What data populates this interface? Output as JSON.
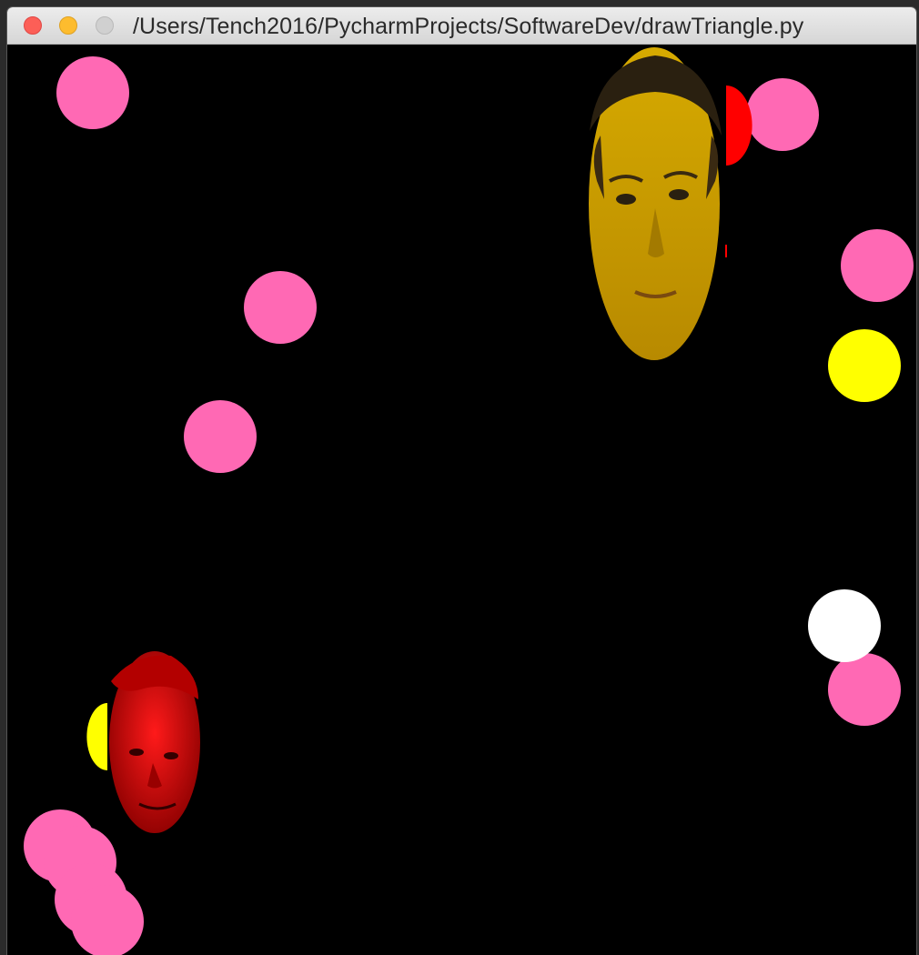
{
  "window": {
    "title": "/Users/Tench2016/PycharmProjects/SoftwareDev/drawTriangle.py",
    "controls": {
      "close": "close-icon",
      "minimize": "minimize-icon",
      "maximize": "maximize-icon"
    }
  },
  "game": {
    "background": "#000000",
    "colors": {
      "pink": "#ff69b4",
      "yellow": "#ffff00",
      "white": "#ffffff",
      "red": "#ff0000",
      "face_yellow": "#c8a000",
      "face_red": "#cc0000"
    },
    "sprites": [
      "pink-ball",
      "yellow-ball",
      "white-ball",
      "red-half-ball",
      "yellow-half-ball",
      "yellow-tinted-face",
      "red-tinted-face"
    ]
  }
}
